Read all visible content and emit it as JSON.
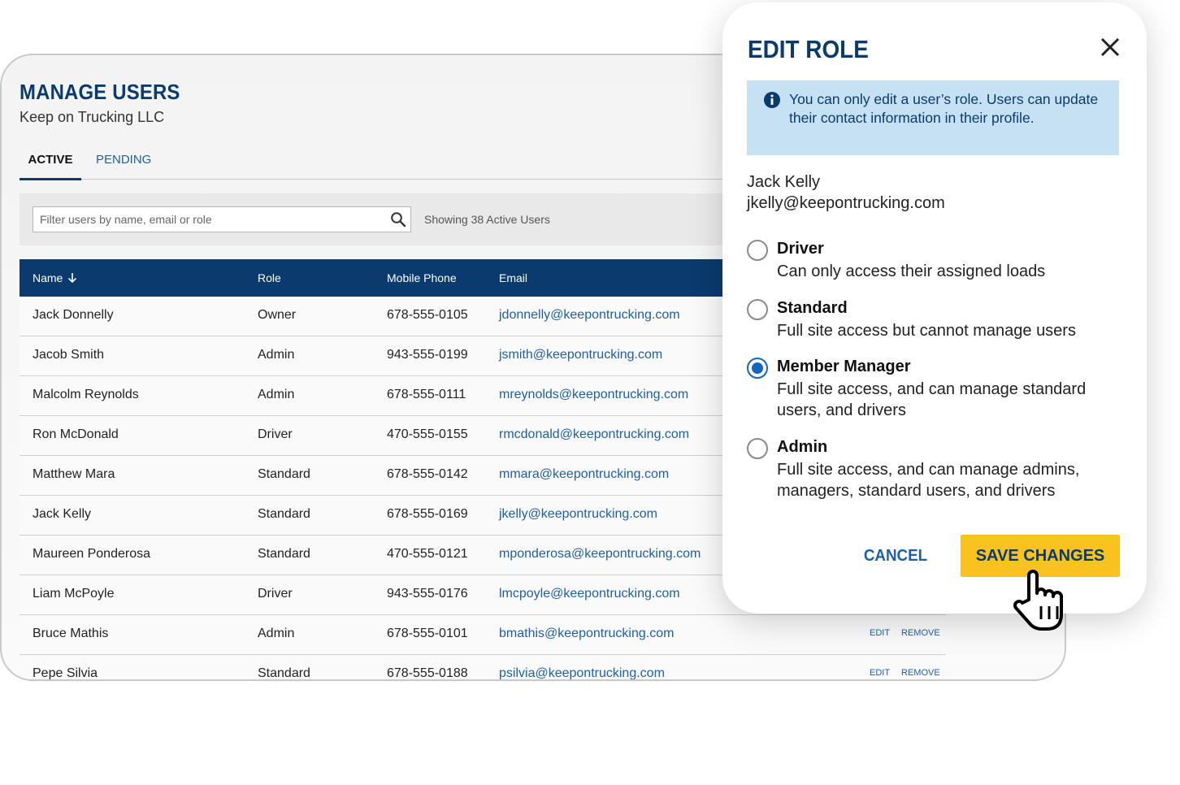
{
  "page": {
    "title": "MANAGE USERS",
    "subtitle": "Keep on Trucking LLC",
    "tabs": [
      {
        "label": "ACTIVE",
        "active": true
      },
      {
        "label": "PENDING",
        "active": false
      }
    ],
    "filter": {
      "placeholder": "Filter users by name, email or role",
      "value": "",
      "showing": "Showing 38 Active Users"
    },
    "table": {
      "columns": [
        "Name",
        "Role",
        "Mobile Phone",
        "Email"
      ],
      "sort_icon": "arrow-down-icon",
      "rows": [
        {
          "name": "Jack Donnelly",
          "role": "Owner",
          "phone": "678-555-0105",
          "email": "jdonnelly@keepontrucking.com",
          "edit": "",
          "remove": ""
        },
        {
          "name": "Jacob Smith",
          "role": "Admin",
          "phone": "943-555-0199",
          "email": "jsmith@keepontrucking.com",
          "edit": "",
          "remove": ""
        },
        {
          "name": "Malcolm Reynolds",
          "role": "Admin",
          "phone": "678-555-0111",
          "email": "mreynolds@keepontrucking.com",
          "edit": "",
          "remove": ""
        },
        {
          "name": "Ron McDonald",
          "role": "Driver",
          "phone": "470-555-0155",
          "email": "rmcdonald@keepontrucking.com",
          "edit": "",
          "remove": ""
        },
        {
          "name": "Matthew Mara",
          "role": "Standard",
          "phone": "678-555-0142",
          "email": "mmara@keepontrucking.com",
          "edit": "",
          "remove": ""
        },
        {
          "name": "Jack Kelly",
          "role": "Standard",
          "phone": "678-555-0169",
          "email": "jkelly@keepontrucking.com",
          "edit": "",
          "remove": ""
        },
        {
          "name": "Maureen Ponderosa",
          "role": "Standard",
          "phone": "470-555-0121",
          "email": "mponderosa@keepontrucking.com",
          "edit": "",
          "remove": ""
        },
        {
          "name": "Liam McPoyle",
          "role": "Driver",
          "phone": "943-555-0176",
          "email": "lmcpoyle@keepontrucking.com",
          "edit": "",
          "remove": ""
        },
        {
          "name": "Bruce Mathis",
          "role": "Admin",
          "phone": "678-555-0101",
          "email": "bmathis@keepontrucking.com",
          "edit": "EDIT",
          "remove": "REMOVE"
        },
        {
          "name": "Pepe Silvia",
          "role": "Standard",
          "phone": "678-555-0188",
          "email": "psilvia@keepontrucking.com",
          "edit": "EDIT",
          "remove": "REMOVE"
        }
      ]
    }
  },
  "modal": {
    "title": "EDIT ROLE",
    "close_icon": "close-icon",
    "info_icon": "info-icon",
    "info": "You can only edit a user’s role. Users can update their contact information in their profile.",
    "user": {
      "name": "Jack Kelly",
      "email": "jkelly@keepontrucking.com"
    },
    "options": [
      {
        "title": "Driver",
        "desc": "Can only access their assigned loads",
        "checked": false
      },
      {
        "title": "Standard",
        "desc": "Full site access but cannot manage users",
        "checked": false
      },
      {
        "title": "Member Manager",
        "desc": "Full site access, and can manage standard users, and drivers",
        "checked": true
      },
      {
        "title": "Admin",
        "desc": "Full site access, and can manage admins, managers, standard users, and drivers",
        "checked": false
      }
    ],
    "cancel_label": "CANCEL",
    "save_label": "SAVE CHANGES"
  },
  "colors": {
    "brand_navy": "#0b3a6e",
    "link_blue": "#1e5fa8",
    "accent_yellow": "#f9c31f",
    "info_bg": "#c6e1f3",
    "radio_selected": "#1565c0"
  },
  "cursor_icon": "hand-pointer-icon"
}
